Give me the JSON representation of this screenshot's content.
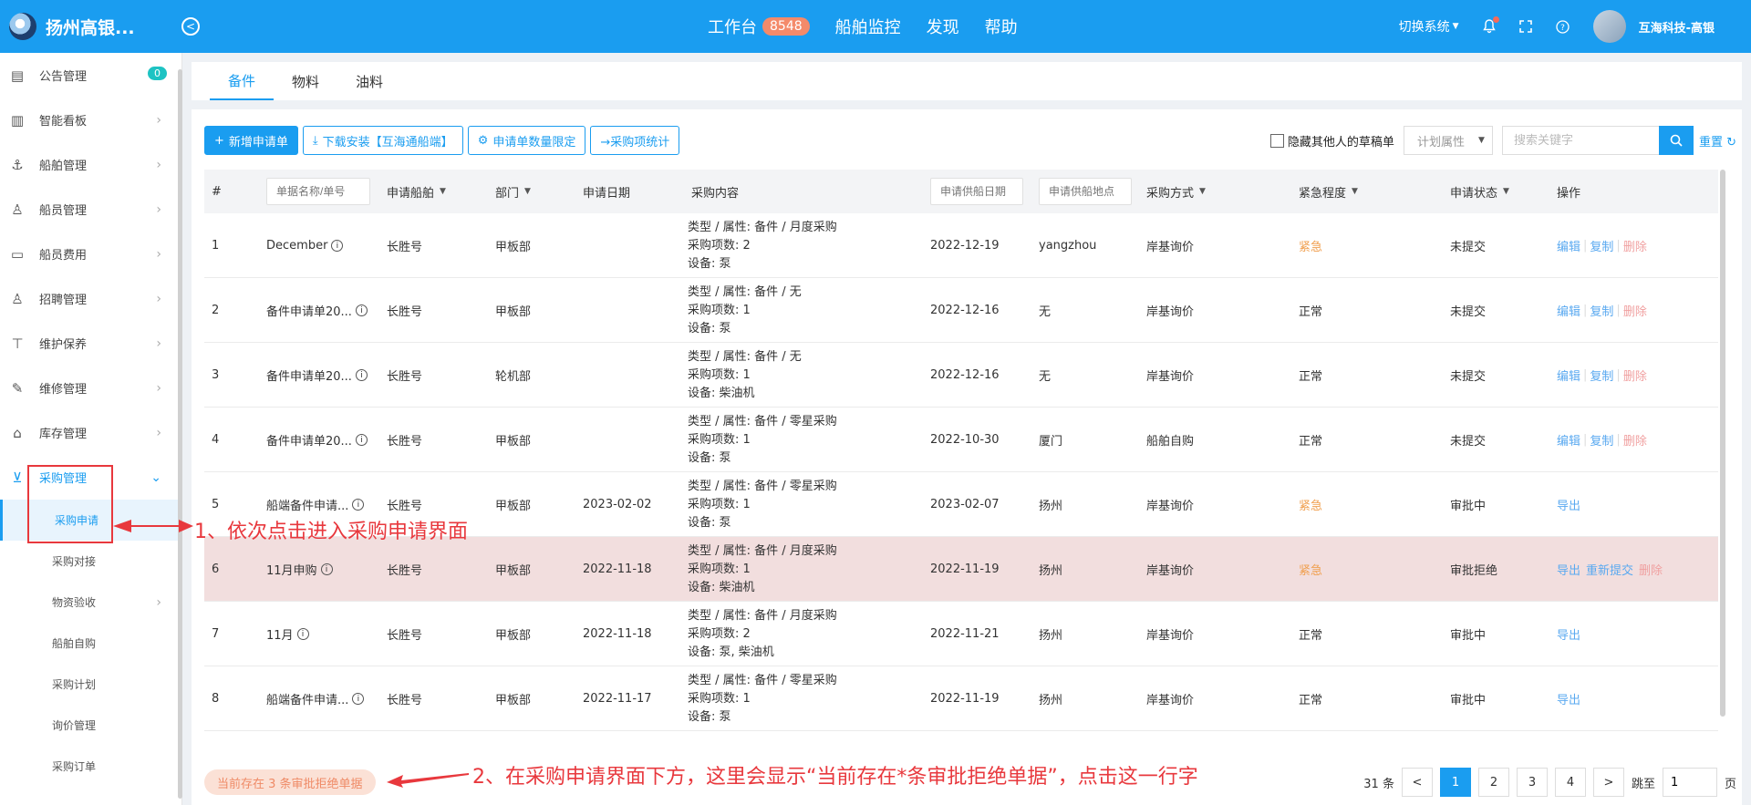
{
  "header": {
    "brand": "扬州高银...",
    "nav": [
      {
        "label": "工作台",
        "badge": "8548"
      },
      {
        "label": "船舶监控"
      },
      {
        "label": "发现"
      },
      {
        "label": "帮助"
      }
    ],
    "switch_system": "切换系统",
    "user": "互海科技-高银"
  },
  "sidebar": {
    "items": [
      {
        "label": "公告管理",
        "icon": "book-icon",
        "count": "0"
      },
      {
        "label": "智能看板",
        "icon": "chart-icon"
      },
      {
        "label": "船舶管理",
        "icon": "anchor-icon"
      },
      {
        "label": "船员管理",
        "icon": "user-icon"
      },
      {
        "label": "船员费用",
        "icon": "wallet-icon"
      },
      {
        "label": "招聘管理",
        "icon": "recruit-icon"
      },
      {
        "label": "维护保养",
        "icon": "brush-icon"
      },
      {
        "label": "维修管理",
        "icon": "wrench-icon"
      },
      {
        "label": "库存管理",
        "icon": "home-icon"
      },
      {
        "label": "采购管理",
        "icon": "cart-icon"
      }
    ],
    "sub_items": [
      "采购申请",
      "采购对接",
      "物资验收",
      "船舶自购",
      "采购计划",
      "询价管理",
      "采购订单"
    ]
  },
  "tabs": [
    "备件",
    "物料",
    "油料"
  ],
  "toolbar": {
    "new_request": "新增申请单",
    "download": "下载安装【互海通船端】",
    "limit": "申请单数量限定",
    "stats": "→采购项统计",
    "hide_drafts": "隐藏其他人的草稿单",
    "plan_attr": "计划属性",
    "search_placeholder": "搜索关键字",
    "reset": "重置"
  },
  "table": {
    "headers": {
      "num": "#",
      "name_placeholder": "单据名称/单号",
      "ship": "申请船舶",
      "dept": "部门",
      "date": "申请日期",
      "content": "采购内容",
      "supply_date_placeholder": "申请供船日期",
      "supply_place_placeholder": "申请供船地点",
      "method": "采购方式",
      "urgency": "紧急程度",
      "status": "申请状态",
      "ops": "操作"
    },
    "rows": [
      {
        "num": "1",
        "name": "December",
        "ship": "长胜号",
        "dept": "甲板部",
        "date": "",
        "c1": "类型 / 属性:  备件 / 月度采购",
        "c2": "采购项数:  2",
        "c3": "设备:   泵",
        "supply_date": "2022-12-19",
        "place": "yangzhou",
        "method": "岸基询价",
        "urgency": "紧急",
        "status": "未提交",
        "ops": [
          "编辑",
          "复制",
          "删除"
        ]
      },
      {
        "num": "2",
        "name": "备件申请单20...",
        "ship": "长胜号",
        "dept": "甲板部",
        "date": "",
        "c1": "类型 / 属性:  备件 / 无",
        "c2": "采购项数:  1",
        "c3": "设备:   泵",
        "supply_date": "2022-12-16",
        "place": "无",
        "method": "岸基询价",
        "urgency": "正常",
        "status": "未提交",
        "ops": [
          "编辑",
          "复制",
          "删除"
        ]
      },
      {
        "num": "3",
        "name": "备件申请单20...",
        "ship": "长胜号",
        "dept": "轮机部",
        "date": "",
        "c1": "类型 / 属性:  备件 / 无",
        "c2": "采购项数:  1",
        "c3": "设备:   柴油机",
        "supply_date": "2022-12-16",
        "place": "无",
        "method": "岸基询价",
        "urgency": "正常",
        "status": "未提交",
        "ops": [
          "编辑",
          "复制",
          "删除"
        ]
      },
      {
        "num": "4",
        "name": "备件申请单20...",
        "ship": "长胜号",
        "dept": "甲板部",
        "date": "",
        "c1": "类型 / 属性:  备件 / 零星采购",
        "c2": "采购项数:  1",
        "c3": "设备:   泵",
        "supply_date": "2022-10-30",
        "place": "厦门",
        "method": "船舶自购",
        "urgency": "正常",
        "status": "未提交",
        "ops": [
          "编辑",
          "复制",
          "删除"
        ]
      },
      {
        "num": "5",
        "name": "船端备件申请...",
        "ship": "长胜号",
        "dept": "甲板部",
        "date": "2023-02-02",
        "c1": "类型 / 属性:  备件 / 零星采购",
        "c2": "采购项数:  1",
        "c3": "设备:   泵",
        "supply_date": "2023-02-07",
        "place": "扬州",
        "method": "岸基询价",
        "urgency": "紧急",
        "status": "审批中",
        "ops": [
          "导出"
        ]
      },
      {
        "num": "6",
        "name": "11月申购",
        "ship": "长胜号",
        "dept": "甲板部",
        "date": "2022-11-18",
        "c1": "类型 / 属性:  备件 / 月度采购",
        "c2": "采购项数:  1",
        "c3": "设备:   柴油机",
        "supply_date": "2022-11-19",
        "place": "扬州",
        "method": "岸基询价",
        "urgency": "紧急",
        "status": "审批拒绝",
        "ops": [
          "导出",
          "重新提交",
          "删除"
        ]
      },
      {
        "num": "7",
        "name": "11月",
        "ship": "长胜号",
        "dept": "甲板部",
        "date": "2022-11-18",
        "c1": "类型 / 属性:  备件 / 月度采购",
        "c2": "采购项数:  2",
        "c3": "设备:   泵, 柴油机",
        "supply_date": "2022-11-21",
        "place": "扬州",
        "method": "岸基询价",
        "urgency": "正常",
        "status": "审批中",
        "ops": [
          "导出"
        ]
      },
      {
        "num": "8",
        "name": "船端备件申请...",
        "ship": "长胜号",
        "dept": "甲板部",
        "date": "2022-11-17",
        "c1": "类型 / 属性:  备件 / 零星采购",
        "c2": "采购项数:  1",
        "c3": "设备:   泵",
        "supply_date": "2022-11-19",
        "place": "扬州",
        "method": "岸基询价",
        "urgency": "正常",
        "status": "审批中",
        "ops": [
          "导出"
        ]
      }
    ]
  },
  "footer": {
    "reject_notice": "当前存在 3 条审批拒绝单据",
    "total": "31 条",
    "pages": [
      "1",
      "2",
      "3",
      "4"
    ],
    "prev": "<",
    "next": ">",
    "jump_label": "跳至",
    "jump_value": "1",
    "page_suffix": "页"
  },
  "annotations": {
    "step1": "1、依次点击进入采购申请界面",
    "step2": "2、在采购申请界面下方，这里会显示“当前存在*条审批拒绝单据”，点击这一行字"
  },
  "colors": {
    "primary": "#1a9df0",
    "annotation": "#e8383d",
    "urgent": "#f0a050",
    "rejected_row": "#f2dede"
  }
}
